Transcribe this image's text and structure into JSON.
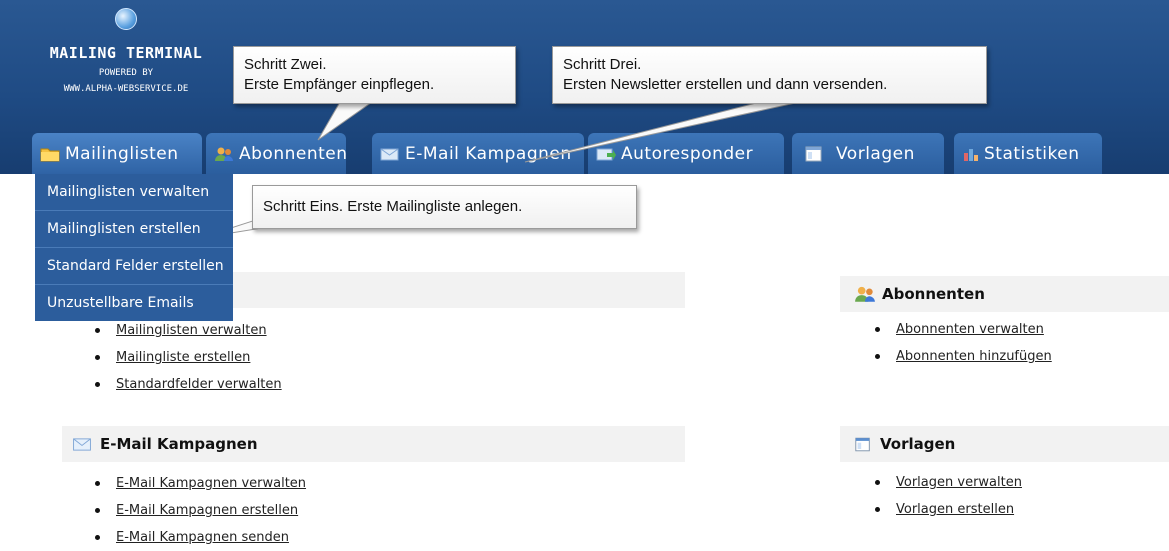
{
  "logo": {
    "title": "MAILING TERMINAL",
    "powered_by": "POWERED BY",
    "url": "WWW.ALPHA-WEBSERVICE.DE",
    "icon": "globe-icon"
  },
  "tabs": [
    {
      "label": "Mailinglisten",
      "icon": "folder-icon"
    },
    {
      "label": "Abonnenten",
      "icon": "users-icon"
    },
    {
      "label": "E-Mail Kampagnen",
      "icon": "envelope-icon"
    },
    {
      "label": "Autoresponder",
      "icon": "mail-arrow-icon"
    },
    {
      "label": "Vorlagen",
      "icon": "template-icon"
    },
    {
      "label": "Statistiken",
      "icon": "bar-chart-icon"
    }
  ],
  "dropdown": {
    "items": [
      "Mailinglisten verwalten",
      "Mailinglisten erstellen",
      "Standard Felder erstellen",
      "Unzustellbare Emails"
    ]
  },
  "callouts": {
    "step_two": {
      "line1": "Schritt Zwei.",
      "line2": "Erste Empfänger einpflegen."
    },
    "step_three": {
      "line1": "Schritt Drei.",
      "line2": "Ersten Newsletter erstellen und dann versenden."
    },
    "step_one": {
      "line1": "Schritt Eins. Erste Mailingliste anlegen."
    }
  },
  "sections": {
    "mailinglisten": {
      "title": "",
      "links": [
        "Mailinglisten verwalten",
        "Mailingliste erstellen",
        "Standardfelder verwalten"
      ]
    },
    "abonnenten": {
      "title": "Abonnenten",
      "links": [
        "Abonnenten verwalten",
        "Abonnenten hinzufügen"
      ]
    },
    "kampagnen": {
      "title": "E-Mail Kampagnen",
      "links": [
        "E-Mail Kampagnen verwalten",
        "E-Mail Kampagnen erstellen",
        "E-Mail Kampagnen senden"
      ]
    },
    "vorlagen": {
      "title": "Vorlagen",
      "links": [
        "Vorlagen verwalten",
        "Vorlagen erstellen"
      ]
    }
  },
  "colors": {
    "header": "#1f4b84",
    "tab": "#3568a8",
    "dropdown": "#2c5d9c",
    "section_bar": "#f2f2f2"
  }
}
